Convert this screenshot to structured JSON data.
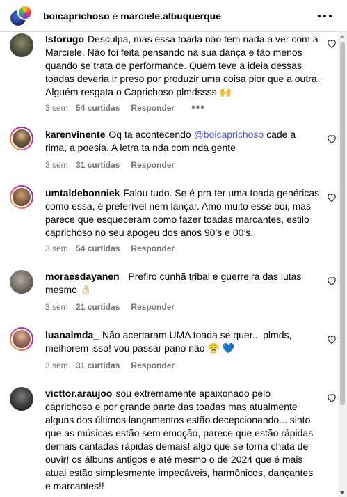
{
  "header": {
    "account_a": "boicaprichoso",
    "conjunction": "e",
    "account_b": "marciele.albuquerque",
    "more_icon": "more-horizontal-icon"
  },
  "comments": [
    {
      "username": "lstorugo",
      "text": "Desculpa, mas essa toada não tem nada a ver com a Marciele. Não foi feita pensando na sua dança e tão menos quando se trata de performance. Quem teve a ideia dessas toadas deveria ir preso por produzir uma coisa pior que a outra. Alguém resgata o Caprichoso plmdssss 🙌",
      "time": "3 sem",
      "likes": "54 curtidas",
      "reply": "Responder",
      "more": "•••"
    },
    {
      "username": "karenvinente",
      "text_before": "Oq ta acontecendo ",
      "mention": "@boicaprichoso",
      "text_after": " cade a rima, a poesia. A letra ta nda com nda gente",
      "time": "3 sem",
      "likes": "31 curtidas",
      "reply": "Responder"
    },
    {
      "username": "umtaldebonniek",
      "text": "Falou tudo. Se é pra ter uma toada genéricas como essa, é preferível nem lançar. Amo muito esse boi, mas parece que esqueceram como fazer toadas marcantes, estilo caprichoso no seu apogeu dos anos 90’s e 00’s.",
      "time": "3 sem",
      "likes": "54 curtidas",
      "reply": "Responder"
    },
    {
      "username": "moraesdayanen_",
      "text": "Prefiro cunhã tribal e guerreira das lutas mesmo 👌🏻",
      "time": "3 sem",
      "likes": "21 curtidas",
      "reply": "Responder"
    },
    {
      "username": "luanalmda_",
      "text": "Não acertaram UMA toada se quer... plmds, melhorem isso! vou passar pano não 😤 💙",
      "time": "3 sem",
      "likes": "31 curtidas",
      "reply": "Responder"
    },
    {
      "username": "victtor.araujoo",
      "text": "sou extremamente apaixonado pelo caprichoso e por grande parte das toadas mas atualmente alguns dos últimos lançamentos estão decepcionando... sinto que as músicas estão sem emoção, parece que estão rápidas demais cantadas rápidas demais! algo que se torna chata de ouvir! os álbuns antigos e até mesmo o de 2024 que é mais atual estão simplesmente impecáveis, harmônicos, dançantes e marcantes!!"
    }
  ],
  "icons": {
    "like": "heart-outline-icon",
    "scroll_up": "scroll-up-arrow-icon",
    "scroll_down": "scroll-down-arrow-icon"
  }
}
